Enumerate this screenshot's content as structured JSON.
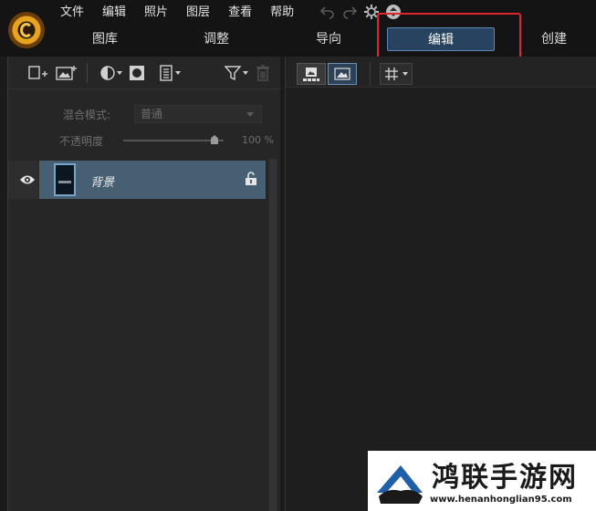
{
  "menu": [
    "文件",
    "编辑",
    "照片",
    "图层",
    "查看",
    "帮助"
  ],
  "modes": [
    "图库",
    "调整",
    "导向",
    "编辑",
    "创建"
  ],
  "active_mode": "编辑",
  "layers_panel": {
    "blend_label": "混合模式:",
    "blend_value": "普通",
    "opacity_label": "不透明度",
    "opacity_value": "100 %",
    "opacity_fraction": 1.0,
    "layers": [
      {
        "name": "背景",
        "visible": true,
        "locked": true
      }
    ]
  },
  "watermark": {
    "title": "鸿联手游网",
    "url": "www.henanhonglian95.com"
  },
  "colors": {
    "accent": "#5b88b6",
    "highlight": "#e0262b",
    "selected_layer": "#475f73"
  }
}
